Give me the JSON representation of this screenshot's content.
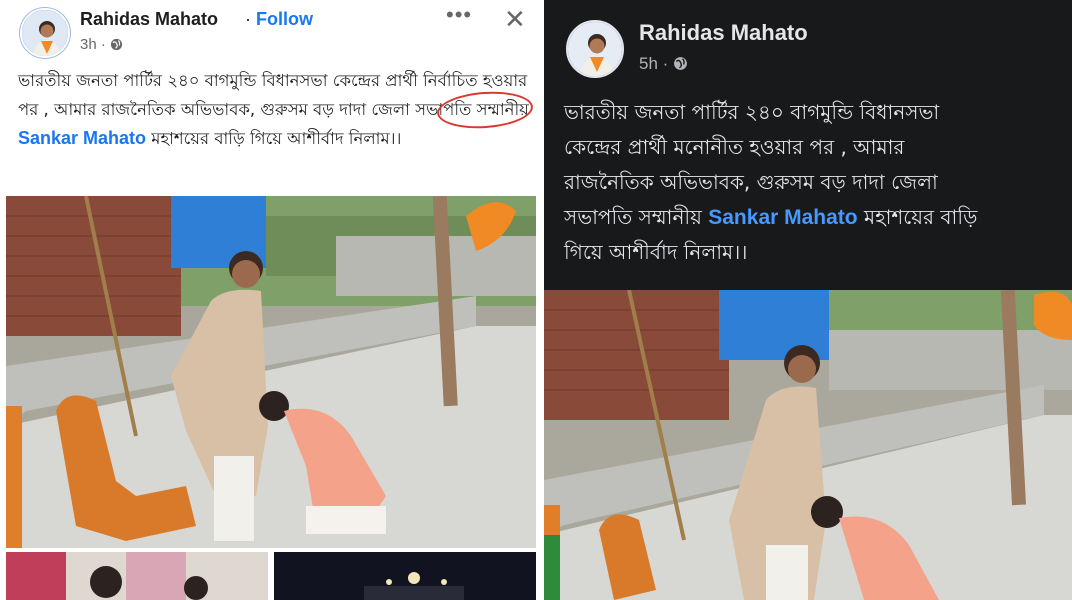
{
  "left_post": {
    "author": "Rahidas Mahato",
    "separator": "·",
    "follow_label": "Follow",
    "timestamp": "3h ·",
    "more_icon": "more-horizontal-icon",
    "close_icon": "close-icon",
    "text_part1": "ভারতীয় জনতা পার্টির ২৪০ বাগমুন্ডি বিধানসভা কেন্দ্রের প্রার্থী নির্বাচিত হওয়ার পর , আমার রাজনৈতিক অভিভাবক, গুরুসম বড় দাদা জেলা সভাপতি সম্মানীয় ",
    "mention": "Sankar Mahato",
    "text_part2": " মহাশয়ের বাড়ি গিয়ে আশীর্বাদ নিলাম।।",
    "annotation_color": "#d93a2f"
  },
  "right_post": {
    "author": "Rahidas Mahato",
    "timestamp": "5h ·",
    "line1": "ভারতীয় জনতা পার্টির ২৪০ বাগমুন্ডি বিধানসভা",
    "line2": "কেন্দ্রের প্রার্থী মনোনীত হওয়ার পর , আমার",
    "line3": "রাজনৈতিক অভিভাবক, গুরুসম বড় দাদা জেলা",
    "line4_pre": "সভাপতি সম্মানীয় ",
    "mention": "Sankar Mahato",
    "line4_post": " মহাশয়ের বাড়ি",
    "line5": "গিয়ে আশীর্বাদ নিলাম।।"
  },
  "colors": {
    "link_blue": "#1877f2",
    "dark_bg": "#18191a",
    "dark_text": "#e4e6eb",
    "dark_link": "#4599ff"
  }
}
